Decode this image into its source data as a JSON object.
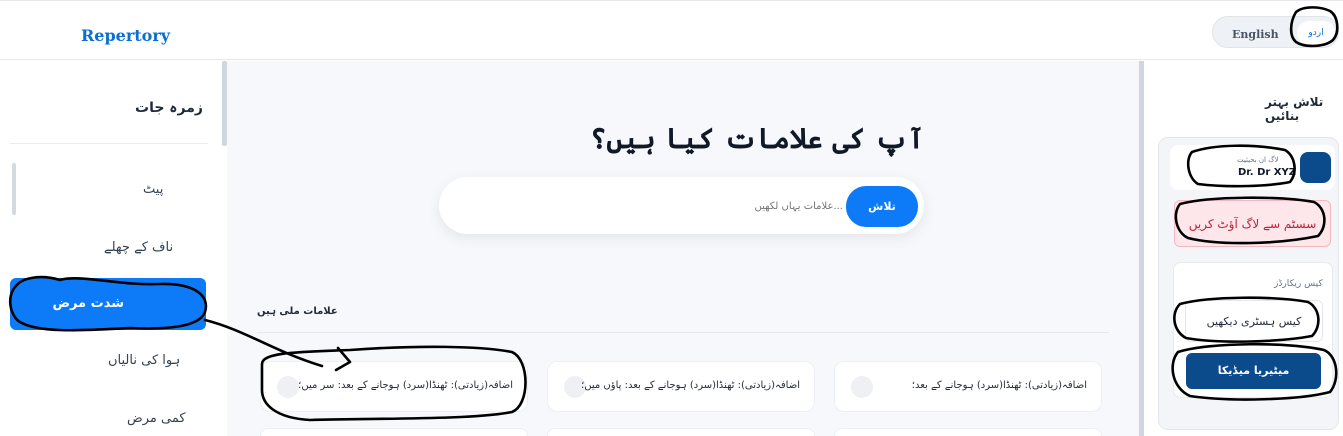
{
  "header": {
    "brand": "Repertory",
    "lang_en": "English",
    "lang_ur": "اردو"
  },
  "sidebar": {
    "title": "زمرہ جات",
    "items": [
      {
        "label": "پیٹ"
      },
      {
        "label": "ناف کے چھلے"
      },
      {
        "label": "شدت مرض"
      },
      {
        "label": "ہوا کی نالیاں"
      },
      {
        "label": "کمی مرض"
      }
    ]
  },
  "main": {
    "heading": "آپ کی علامات کیا ہیں؟",
    "search_placeholder": "علامات یہاں لکھیں...",
    "search_button": "تلاش",
    "results_label": "علامات ملی ہیں",
    "results": [
      {
        "text": "اضافہ(زیادتی): ٹھنڈا(سرد) ہوجانے کے بعد: سر میں؛"
      },
      {
        "text": "اضافہ(زیادتی): ٹھنڈا(سرد) ہوجانے کے بعد: پاؤں میں؛"
      },
      {
        "text": "اضافہ(زیادتی): ٹھنڈا(سرد) ہوجانے کے بعد؛"
      }
    ]
  },
  "right_panel": {
    "title": "تلاش بہتر بنائیں",
    "user_sub": "لاگ ان بحیثیت",
    "user_name": "Dr. Dr XYZ",
    "logout": "سسٹم سے لاگ آؤٹ کریں",
    "cases_label": "کیس ریکارڈز",
    "history_button": "کیس ہسٹری دیکھیں",
    "media_button": "میٹیریا میڈیکا"
  },
  "colors": {
    "accent": "#0d7bf7",
    "brand": "#0b6fd1",
    "navy": "#0b4a8b",
    "logout_bg": "#fde7ea",
    "logout_text": "#c0223b"
  }
}
